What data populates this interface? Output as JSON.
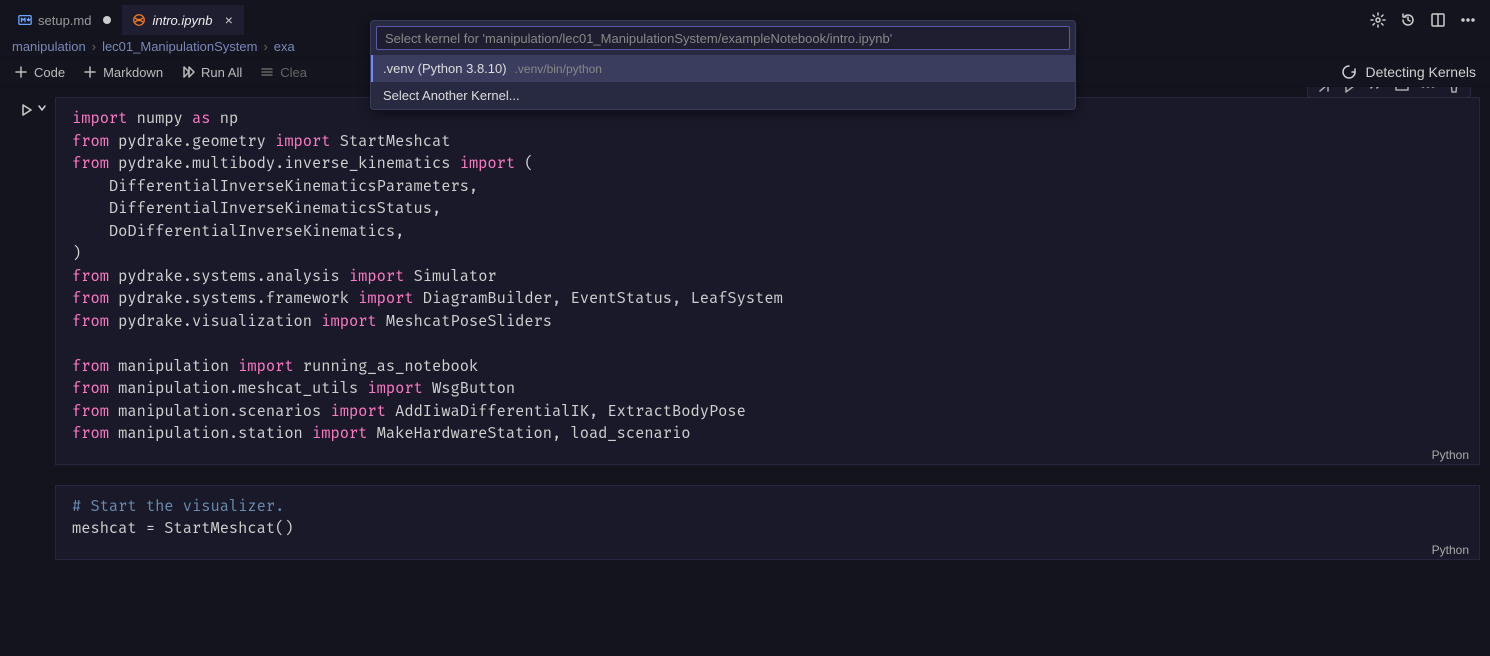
{
  "tabs": [
    {
      "label": "setup.md",
      "icon": "markdown",
      "dirty": true,
      "active": false
    },
    {
      "label": "intro.ipynb",
      "icon": "jupyter",
      "dirty": false,
      "active": true
    }
  ],
  "breadcrumbs": [
    "manipulation",
    "lec01_ManipulationSystem",
    "exa"
  ],
  "nb_toolbar": {
    "code": "Code",
    "markdown": "Markdown",
    "run_all": "Run All",
    "clear": "Clea"
  },
  "kernel_status": "Detecting Kernels",
  "quickpick": {
    "placeholder": "Select kernel for 'manipulation/lec01_ManipulationSystem/exampleNotebook/intro.ipynb'",
    "items": [
      {
        "main": ".venv (Python 3.8.10)",
        "sub": ".venv/bin/python",
        "selected": true
      },
      {
        "main": "Select Another Kernel...",
        "sub": "",
        "selected": false
      }
    ]
  },
  "cell_lang": "Python",
  "cells": [
    {
      "code_html": "<span class=\"kw\">import</span> numpy <span class=\"kw\">as</span> np\n<span class=\"kw\">from</span> pydrake.geometry <span class=\"kw\">import</span> StartMeshcat\n<span class=\"kw\">from</span> pydrake.multibody.inverse_kinematics <span class=\"kw\">import</span> (\n    DifferentialInverseKinematicsParameters,\n    DifferentialInverseKinematicsStatus,\n    DoDifferentialInverseKinematics,\n)\n<span class=\"kw\">from</span> pydrake.systems.analysis <span class=\"kw\">import</span> Simulator\n<span class=\"kw\">from</span> pydrake.systems.framework <span class=\"kw\">import</span> DiagramBuilder, EventStatus, LeafSystem\n<span class=\"kw\">from</span> pydrake.visualization <span class=\"kw\">import</span> MeshcatPoseSliders\n\n<span class=\"kw\">from</span> manipulation <span class=\"kw\">import</span> running_as_notebook\n<span class=\"kw\">from</span> manipulation.meshcat_utils <span class=\"kw\">import</span> WsgButton\n<span class=\"kw\">from</span> manipulation.scenarios <span class=\"kw\">import</span> AddIiwaDifferentialIK, ExtractBodyPose\n<span class=\"kw\">from</span> manipulation.station <span class=\"kw\">import</span> MakeHardwareStation, load_scenario"
    },
    {
      "code_html": "<span class=\"cmt\"># Start the visualizer.</span>\nmeshcat = StartMeshcat()"
    }
  ]
}
